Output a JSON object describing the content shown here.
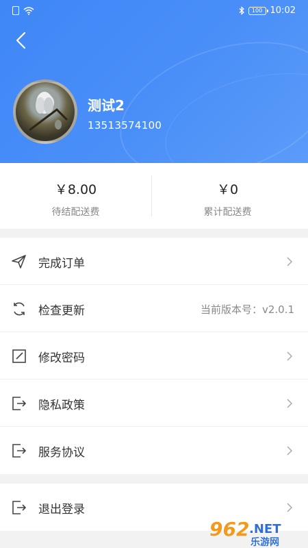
{
  "status_bar": {
    "time": "10:02",
    "battery": "100"
  },
  "profile": {
    "name": "测试2",
    "phone": "13513574100"
  },
  "stats": {
    "pending": {
      "value": "￥8.00",
      "label": "待结配送费"
    },
    "total": {
      "value": "￥0",
      "label": "累计配送费"
    }
  },
  "menu": {
    "items": [
      {
        "label": "完成订单",
        "icon": "send-icon"
      },
      {
        "label": "检查更新",
        "icon": "refresh-icon",
        "extra": "当前版本号：v2.0.1"
      },
      {
        "label": "修改密码",
        "icon": "edit-icon"
      },
      {
        "label": "隐私政策",
        "icon": "exit-box-icon"
      },
      {
        "label": "服务协议",
        "icon": "exit-box-icon"
      }
    ],
    "logout": {
      "label": "退出登录",
      "icon": "exit-box-icon"
    }
  },
  "watermark": {
    "brand": "962",
    "suffix": ".NET",
    "sub": "乐游网"
  },
  "colors": {
    "header": "#4a8ff8",
    "watermark_orange": "#f39a1e",
    "watermark_blue": "#2f6fd8"
  }
}
